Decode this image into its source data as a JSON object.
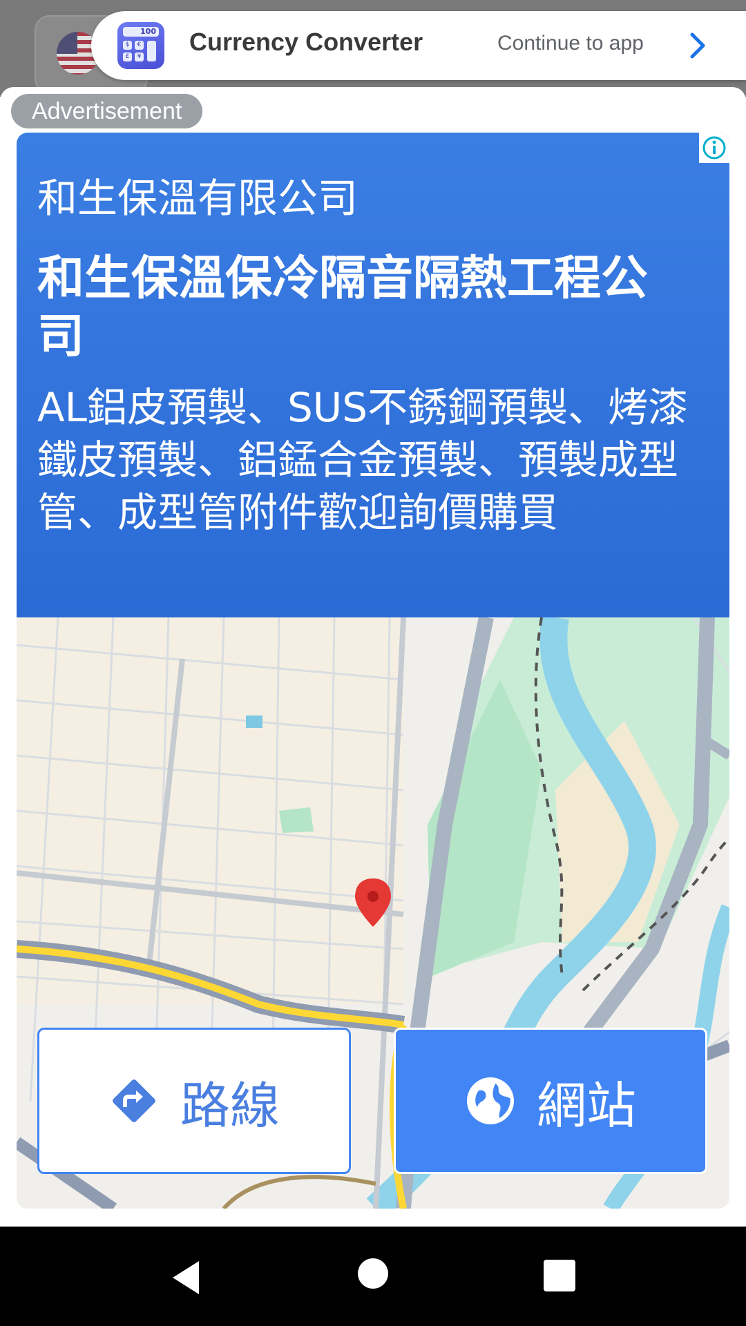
{
  "banner": {
    "app_name": "Currency Converter",
    "continue_label": "Continue to app",
    "icon_display": "100",
    "icon_keys": [
      "$",
      "€",
      "£",
      "¥"
    ]
  },
  "ad": {
    "label": "Advertisement",
    "company_name": "和生保溫有限公司",
    "headline": "和生保溫保冷隔音隔熱工程公司",
    "description": "AL鋁皮預製、SUS不銹鋼預製、烤漆鐵皮預製、鋁錳合金預製、預製成型管、成型管附件歡迎詢價購買",
    "buttons": {
      "directions_label": "路線",
      "website_label": "網站"
    }
  },
  "colors": {
    "brand_blue": "#4285f4",
    "ad_header_blue": "#3b7ee3",
    "map_pin": "#e53935"
  },
  "icons": {
    "back": "triangle-back-icon",
    "home": "circle-home-icon",
    "recents": "square-recents-icon",
    "info": "info-icon",
    "directions": "directions-diamond-icon",
    "website": "globe-icon",
    "continue": "chevron-right-icon"
  }
}
